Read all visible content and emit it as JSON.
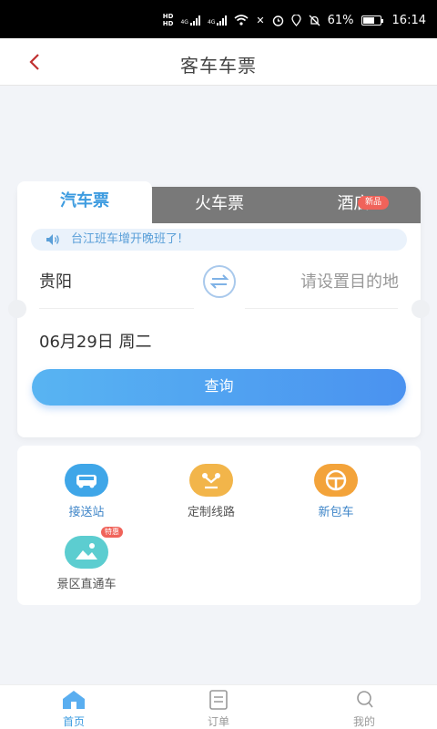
{
  "status_bar": {
    "battery": "61%",
    "time": "16:14",
    "network_label": "4G",
    "hd_label": "HD"
  },
  "header": {
    "title": "客车车票"
  },
  "tabs": [
    {
      "label": "汽车票"
    },
    {
      "label": "火车票"
    },
    {
      "label": "酒店",
      "badge": "新品"
    }
  ],
  "notice": {
    "text": "台江班车增开晚班了!"
  },
  "route": {
    "from": "贵阳",
    "to_placeholder": "请设置目的地"
  },
  "date": {
    "text": "06月29日 周二"
  },
  "query_button": {
    "label": "查询"
  },
  "services": [
    {
      "label": "接送站",
      "icon": "car-icon"
    },
    {
      "label": "定制线路",
      "icon": "route-icon"
    },
    {
      "label": "新包车",
      "icon": "steering-wheel-icon"
    },
    {
      "label": "景区直通车",
      "icon": "landscape-icon",
      "badge": "特惠"
    }
  ],
  "bottom_nav": [
    {
      "label": "首页",
      "icon": "home-icon",
      "active": true
    },
    {
      "label": "订单",
      "icon": "orders-icon"
    },
    {
      "label": "我的",
      "icon": "profile-icon"
    }
  ],
  "colors": {
    "accent": "#3e9ce0",
    "back": "#c03030",
    "badge": "#f0635a"
  }
}
